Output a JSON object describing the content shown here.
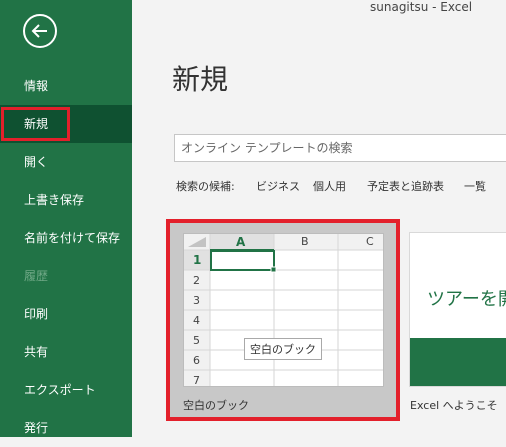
{
  "window": {
    "title": "sunagitsu  -  Excel"
  },
  "sidebar": {
    "items": [
      {
        "label": "情報"
      },
      {
        "label": "新規"
      },
      {
        "label": "開く"
      },
      {
        "label": "上書き保存"
      },
      {
        "label": "名前を付けて保存"
      },
      {
        "label": "履歴"
      },
      {
        "label": "印刷"
      },
      {
        "label": "共有"
      },
      {
        "label": "エクスポート"
      },
      {
        "label": "発行"
      }
    ]
  },
  "main": {
    "title": "新規",
    "search": {
      "placeholder": "オンライン テンプレートの検索"
    },
    "suggestions": {
      "label": "検索の候補:",
      "items": [
        "ビジネス",
        "個人用",
        "予定表と追跡表",
        "一覧"
      ]
    },
    "templates": [
      {
        "label": "空白のブック",
        "tooltip": "空白のブック",
        "columns": [
          "A",
          "B",
          "C"
        ],
        "rows": [
          "1",
          "2",
          "3",
          "4",
          "5",
          "6",
          "7"
        ]
      },
      {
        "label": "Excel へようこそ",
        "preview_text": "ツアーを開"
      }
    ]
  },
  "colors": {
    "accent": "#217346",
    "highlight": "#e3202b"
  }
}
